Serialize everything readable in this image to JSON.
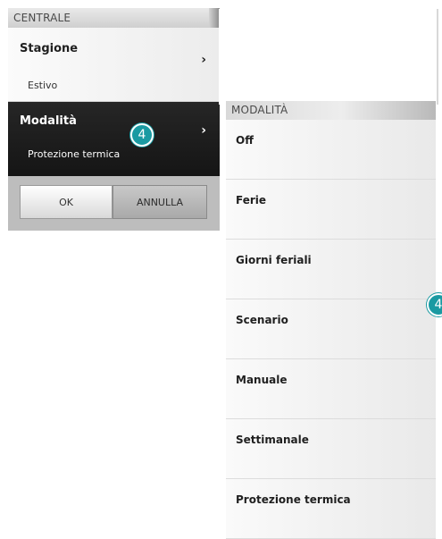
{
  "left_panel": {
    "header": "CENTRALE",
    "season": {
      "title": "Stagione",
      "value": "Estivo",
      "chevron": "›"
    },
    "mode": {
      "title": "Modalità",
      "value": "Protezione termica",
      "chevron": "›"
    },
    "buttons": {
      "ok": "OK",
      "cancel": "ANNULLA"
    },
    "badge": "4"
  },
  "right_panel": {
    "header": "MODALITÀ",
    "options": [
      {
        "label": "Off"
      },
      {
        "label": "Ferie"
      },
      {
        "label": "Giorni feriali"
      },
      {
        "label": "Scenario"
      },
      {
        "label": "Manuale"
      },
      {
        "label": "Settimanale"
      },
      {
        "label": "Protezione termica"
      }
    ],
    "badge": "4"
  },
  "colors": {
    "badge": "#1a9aa2",
    "selected_row": "#1e1e1e"
  }
}
